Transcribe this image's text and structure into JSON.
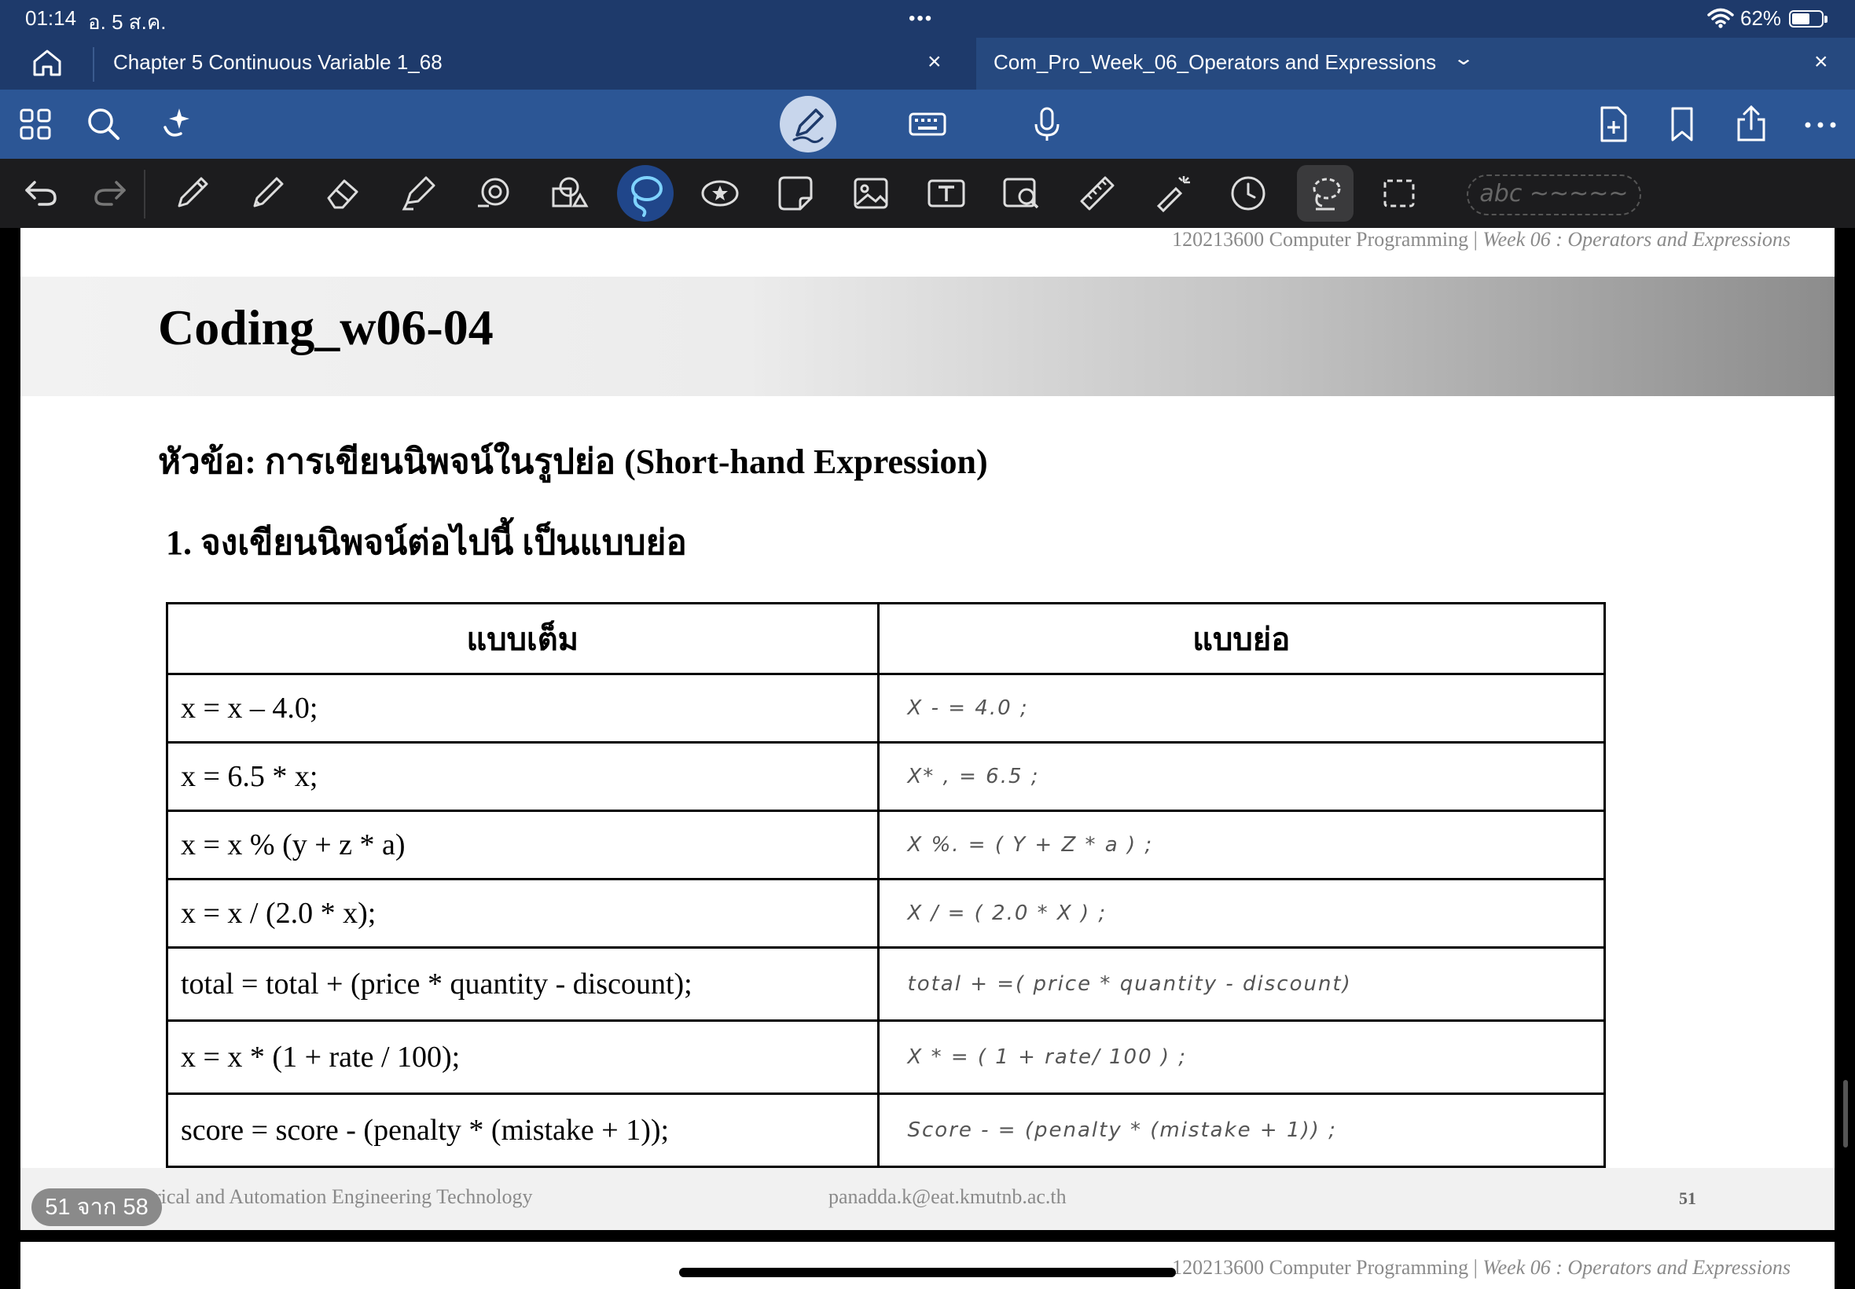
{
  "status": {
    "time": "01:14",
    "date": "อ. 5 ส.ค.",
    "dots": "•••",
    "battery": "62%",
    "battery_level": 0.62
  },
  "tabs": {
    "tab1": {
      "title": "Chapter 5 Continuous Variable 1_68",
      "close": "×"
    },
    "tab2": {
      "title": "Com_Pro_Week_06_Operators and Expressions",
      "close": "×",
      "chevron": "⌄"
    }
  },
  "icons": {
    "status": [
      "wifi-icon",
      "battery-icon"
    ],
    "tabbar": [
      "home-icon"
    ],
    "toolbar": [
      "grid-icon",
      "search-icon",
      "sparkle-icon",
      "pen-mode-icon",
      "keyboard-icon",
      "microphone-icon",
      "new-page-icon",
      "bookmark-icon",
      "share-icon",
      "more-icon"
    ],
    "tools": [
      "undo-icon",
      "redo-icon",
      "pen-icon",
      "pencil-icon",
      "eraser-icon",
      "highlighter-icon",
      "shape-icon",
      "elements-icon",
      "lasso-icon",
      "sticker-icon",
      "sticky-note-icon",
      "image-icon",
      "text-icon",
      "image-search-icon",
      "ruler-icon",
      "laser-pointer-icon",
      "clock-icon",
      "lasso-select-icon",
      "selection-icon"
    ]
  },
  "tools": {
    "abc_label": "abc ~~~~~"
  },
  "document": {
    "header": {
      "text": "120213600 Computer Programming | ",
      "italic": "Week 06 : Operators and Expressions"
    },
    "banner_title": "Coding_w06-04",
    "topic": "หัวข้อ: การเขียนนิพจน์ในรูปย่อ (Short-hand Expression)",
    "question": "1. จงเขียนนิพจน์ต่อไปนี้ เป็นแบบย่อ",
    "table": {
      "headers": [
        "แบบเต็ม",
        "แบบย่อ"
      ],
      "rows": [
        {
          "full": "x = x – 4.0;",
          "short": "X - = 4.0 ;"
        },
        {
          "full": "x = 6.5 * x;",
          "short": "X* , = 6.5 ;"
        },
        {
          "full": "x = x % (y + z * a)",
          "short": "X %. = ( Y + Z * a ) ;"
        },
        {
          "full": "x = x / (2.0 * x);",
          "short": "X / = ( 2.0 * X ) ;"
        },
        {
          "full": "total = total + (price * quantity - discount);",
          "short": "total + =( price * quantity - discount)"
        },
        {
          "full": "x = x * (1 + rate / 100);",
          "short": "X * = ( 1 + rate/ 100 ) ;"
        },
        {
          "full": "score = score - (penalty * (mistake + 1));",
          "short": "Score - = (penalty * (mistake + 1)) ;"
        }
      ]
    },
    "footer": {
      "left": "rical and Automation Engineering Technology",
      "email": "panadda.k@eat.kmutnb.ac.th",
      "page": "51"
    },
    "page_badge": "51 จาก 58",
    "next_header": {
      "text": "120213600 Computer Programming | ",
      "italic": "Week 06 : Operators and Expressions"
    }
  }
}
